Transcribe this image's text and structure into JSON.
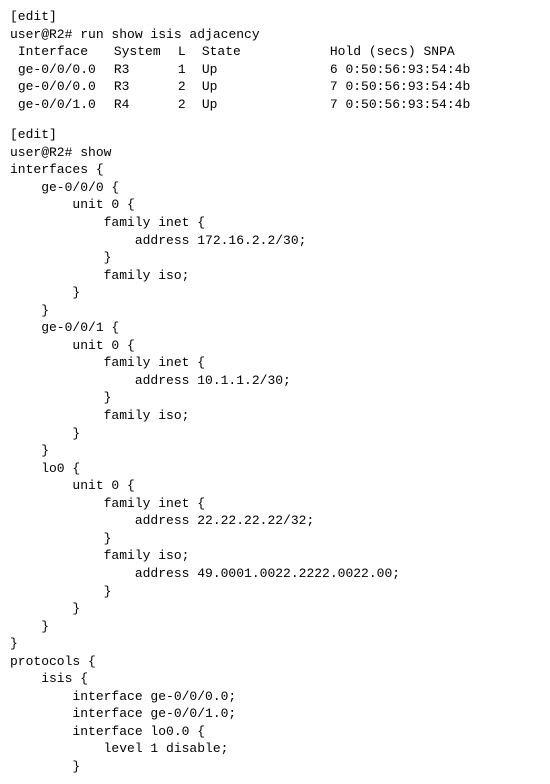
{
  "cli": {
    "edit_mode1": "[edit]",
    "prompt1": "user@R2# ",
    "cmd1": "run show isis adjacency",
    "adjacency": {
      "headers": {
        "interface": "Interface",
        "system": "System",
        "l": "L",
        "state": "State",
        "hold": "Hold",
        "secs": "(secs)",
        "snpa": "SNPA"
      },
      "rows": [
        {
          "interface": "ge-0/0/0.0",
          "system": "R3",
          "l": "1",
          "state": "Up",
          "hold": "6",
          "snpa": "0:50:56:93:54:4b"
        },
        {
          "interface": "ge-0/0/0.0",
          "system": "R3",
          "l": "2",
          "state": "Up",
          "hold": "7",
          "snpa": "0:50:56:93:54:4b"
        },
        {
          "interface": "ge-0/0/1.0",
          "system": "R4",
          "l": "2",
          "state": "Up",
          "hold": "7",
          "snpa": "0:50:56:93:54:4b"
        }
      ]
    },
    "edit_mode2": "[edit]",
    "prompt2": "user@R2# ",
    "cmd2": "show",
    "config": {
      "l01": "interfaces {",
      "l02": "    ge-0/0/0 {",
      "l03": "        unit 0 {",
      "l04": "            family inet {",
      "l05": "                address 172.16.2.2/30;",
      "l06": "            }",
      "l07": "            family iso;",
      "l08": "        }",
      "l09": "    }",
      "l10": "    ge-0/0/1 {",
      "l11": "        unit 0 {",
      "l12": "            family inet {",
      "l13": "                address 10.1.1.2/30;",
      "l14": "            }",
      "l15": "            family iso;",
      "l16": "        }",
      "l17": "    }",
      "l18": "    lo0 {",
      "l19": "        unit 0 {",
      "l20": "            family inet {",
      "l21": "                address 22.22.22.22/32;",
      "l22": "            }",
      "l23": "            family iso;",
      "l24": "                address 49.0001.0022.2222.0022.00;",
      "l25": "            }",
      "l26": "        }",
      "l27": "    }",
      "l28": "}",
      "l29": "protocols {",
      "l30": "    isis {",
      "l31": "        interface ge-0/0/0.0;",
      "l32": "        interface ge-0/0/1.0;",
      "l33": "        interface lo0.0 {",
      "l34": "            level 1 disable;",
      "l35": "        }"
    }
  }
}
